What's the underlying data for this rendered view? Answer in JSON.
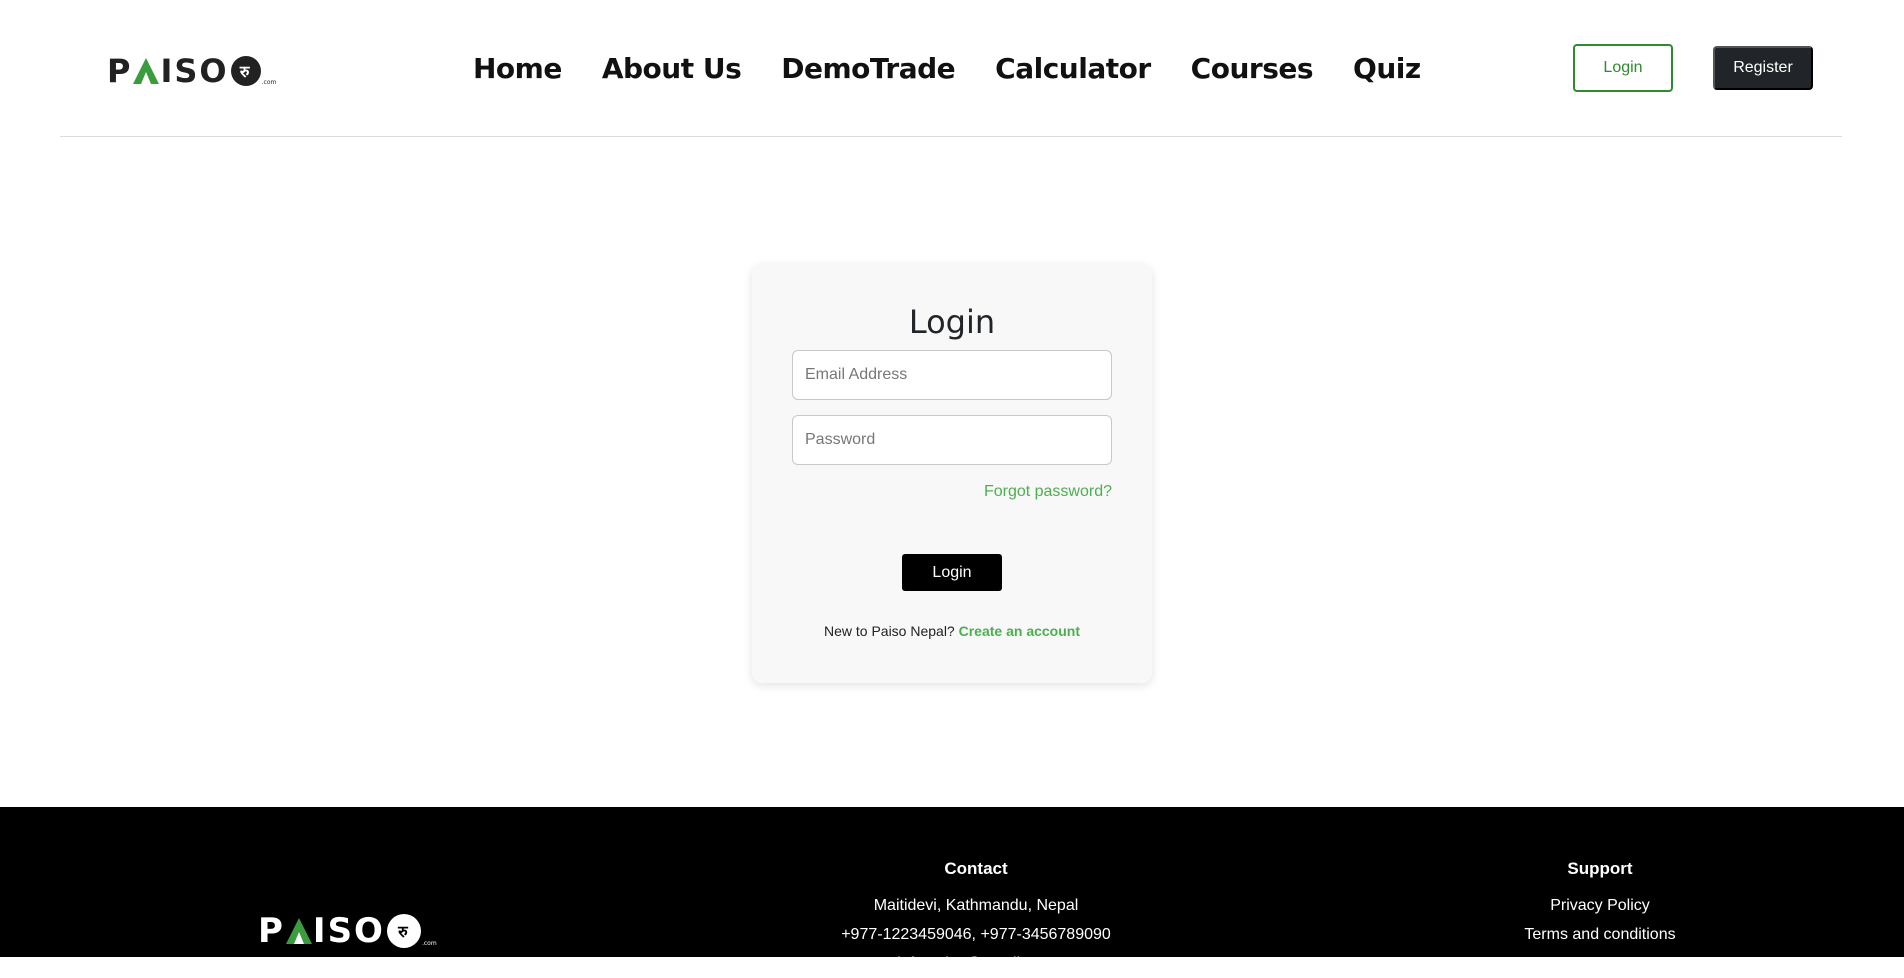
{
  "header": {
    "logo": {
      "left": "P",
      "right": "ISO",
      "coin": "रु",
      "suffix": ".com"
    },
    "nav": [
      "Home",
      "About Us",
      "DemoTrade",
      "Calculator",
      "Courses",
      "Quiz"
    ],
    "login_label": "Login",
    "register_label": "Register"
  },
  "login_card": {
    "title": "Login",
    "email_placeholder": "Email Address",
    "password_placeholder": "Password",
    "forgot_label": "Forgot password?",
    "submit_label": "Login",
    "signup_prompt": "New to Paiso Nepal?",
    "signup_link": "Create an account"
  },
  "footer": {
    "logo": {
      "left": "P",
      "right": "ISO",
      "coin": "रु",
      "suffix": ".com"
    },
    "contact": {
      "heading": "Contact",
      "address": "Maitidevi, Kathmandu, Nepal",
      "phones": "+977-1223459046, +977-3456789090",
      "email": "info.paiso@gmail.com"
    },
    "support": {
      "heading": "Support",
      "links": [
        "Privacy Policy",
        "Terms and conditions"
      ]
    }
  },
  "colors": {
    "accent_green": "#4caf50",
    "brand_green": "#3a9b3f",
    "dark": "#212529"
  }
}
